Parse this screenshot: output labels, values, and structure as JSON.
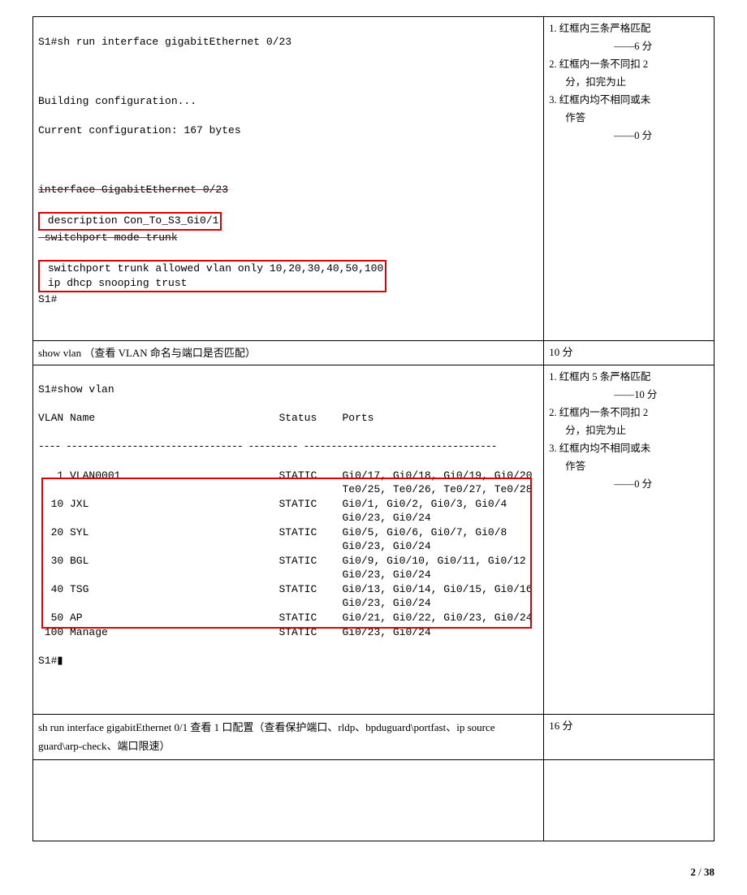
{
  "section1": {
    "cmd_line": "S1#sh run interface gigabitEthernet 0/23",
    "building": "Building configuration...",
    "current": "Current configuration: 167 bytes",
    "iface_line": "interface GigabitEthernet 0/23",
    "desc_line": " description Con_To_S3_Gi0/1",
    "mode_line": " switchport mode trunk",
    "trunk_line": "switchport trunk allowed vlan only 10,20,30,40,50,100",
    "dhcp_line": "ip dhcp snooping trust",
    "end_prompt": "S1#",
    "criteria": {
      "c1": "1. 红框内三条严格匹配",
      "c1s": "——6 分",
      "c2a": "2. 红框内一条不同扣 2",
      "c2b": "分，扣完为止",
      "c3a": "3. 红框内均不相同或未",
      "c3b": "作答",
      "c3s": "——0 分"
    }
  },
  "section2": {
    "desc": "show vlan （查看 VLAN 命名与端口是否匹配）",
    "score": "10 分",
    "header_cmd": "S1#show vlan",
    "header_cols": "VLAN Name                             Status    Ports",
    "rows": [
      {
        "v": "   1 VLAN0001                         STATIC    Gi0/17, Gi0/18, Gi0/19, Gi0/20",
        "extra": "                                                Te0/25, Te0/26, Te0/27, Te0/28"
      },
      {
        "v": "  10 JXL                              STATIC    Gi0/1, Gi0/2, Gi0/3, Gi0/4",
        "extra": "                                                Gi0/23, Gi0/24"
      },
      {
        "v": "  20 SYL                              STATIC    Gi0/5, Gi0/6, Gi0/7, Gi0/8",
        "extra": "                                                Gi0/23, Gi0/24"
      },
      {
        "v": "  30 BGL                              STATIC    Gi0/9, Gi0/10, Gi0/11, Gi0/12",
        "extra": "                                                Gi0/23, Gi0/24"
      },
      {
        "v": "  40 TSG                              STATIC    Gi0/13, Gi0/14, Gi0/15, Gi0/16",
        "extra": "                                                Gi0/23, Gi0/24"
      },
      {
        "v": "  50 AP                               STATIC    Gi0/21, Gi0/22, Gi0/23, Gi0/24",
        "extra": ""
      },
      {
        "v": " 100 Manage                           STATIC    Gi0/23, Gi0/24",
        "extra": ""
      }
    ],
    "end_prompt": "S1#▮",
    "criteria": {
      "c1": "1. 红框内 5 条严格匹配",
      "c1s": "——10 分",
      "c2a": "2. 红框内一条不同扣 2",
      "c2b": "分，扣完为止",
      "c3a": "3. 红框内均不相同或未",
      "c3b": "作答",
      "c3s": "——0 分"
    }
  },
  "section3": {
    "desc": "sh run interface gigabitEthernet 0/1 查看 1 口配置（查看保护端口、rldp、bpduguard\\portfast、ip source guard\\arp-check、端口限速）",
    "score": "16 分"
  },
  "footer": {
    "page": "2",
    "sep": " / ",
    "total": "38"
  }
}
